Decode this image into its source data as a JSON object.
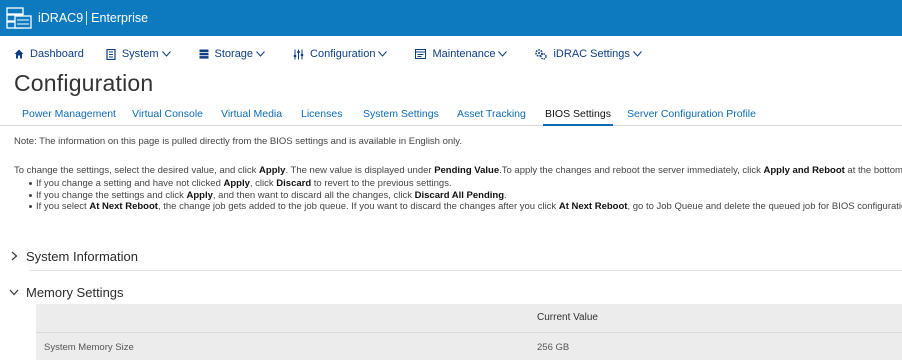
{
  "header": {
    "product": "iDRAC9",
    "edition": "Enterprise",
    "bar_color": "#0d7ac0",
    "logo_icon": "server-rack-icon"
  },
  "nav": [
    {
      "label": "Dashboard",
      "icon": "home-icon",
      "has_dropdown": false
    },
    {
      "label": "System",
      "icon": "system-icon",
      "has_dropdown": true
    },
    {
      "label": "Storage",
      "icon": "storage-icon",
      "has_dropdown": true
    },
    {
      "label": "Configuration",
      "icon": "sliders-icon",
      "has_dropdown": true
    },
    {
      "label": "Maintenance",
      "icon": "maintenance-icon",
      "has_dropdown": true
    },
    {
      "label": "iDRAC Settings",
      "icon": "gears-icon",
      "has_dropdown": true
    }
  ],
  "page_title": "Configuration",
  "tabs": [
    {
      "label": "Power Management",
      "active": false
    },
    {
      "label": "Virtual Console",
      "active": false
    },
    {
      "label": "Virtual Media",
      "active": false
    },
    {
      "label": "Licenses",
      "active": false
    },
    {
      "label": "System Settings",
      "active": false
    },
    {
      "label": "Asset Tracking",
      "active": false
    },
    {
      "label": "BIOS Settings",
      "active": true
    },
    {
      "label": "Server Configuration Profile",
      "active": false
    }
  ],
  "note": "Note: The information on this page is pulled directly from the BIOS settings and is available in English only.",
  "intro": {
    "t1": "To change the settings, select the desired value, and click ",
    "b1": "Apply",
    "t2": ". The new value is displayed under ",
    "b2": "Pending Value",
    "t3": ".To apply the changes and reboot the server immediately, click ",
    "b3": "Apply and Reboot",
    "t4": " at the bottom of"
  },
  "bullets": [
    {
      "t1": "If you change a setting and have not clicked ",
      "b1": "Apply",
      "t2": ", click ",
      "b2": "Discard",
      "t3": " to revert to the previous settings."
    },
    {
      "t1": "If you change the settings and click ",
      "b1": "Apply",
      "t2": ", and then want to discard all the changes, click ",
      "b2": "Discard All Pending",
      "t3": "."
    },
    {
      "t1": "If you select ",
      "b1": "At Next Reboot",
      "t2": ", the change job gets added to the job queue. If you want to discard the changes after you click ",
      "b2": "At Next Reboot",
      "t3": ", go to Job Queue and delete the queued job for BIOS configuratio"
    }
  ],
  "sections": [
    {
      "label": "System Information",
      "expanded": false
    },
    {
      "label": "Memory Settings",
      "expanded": true
    }
  ],
  "memory_table": {
    "column_header": "Current Value",
    "rows": [
      {
        "label": "System Memory Size",
        "value": "256 GB"
      }
    ]
  }
}
